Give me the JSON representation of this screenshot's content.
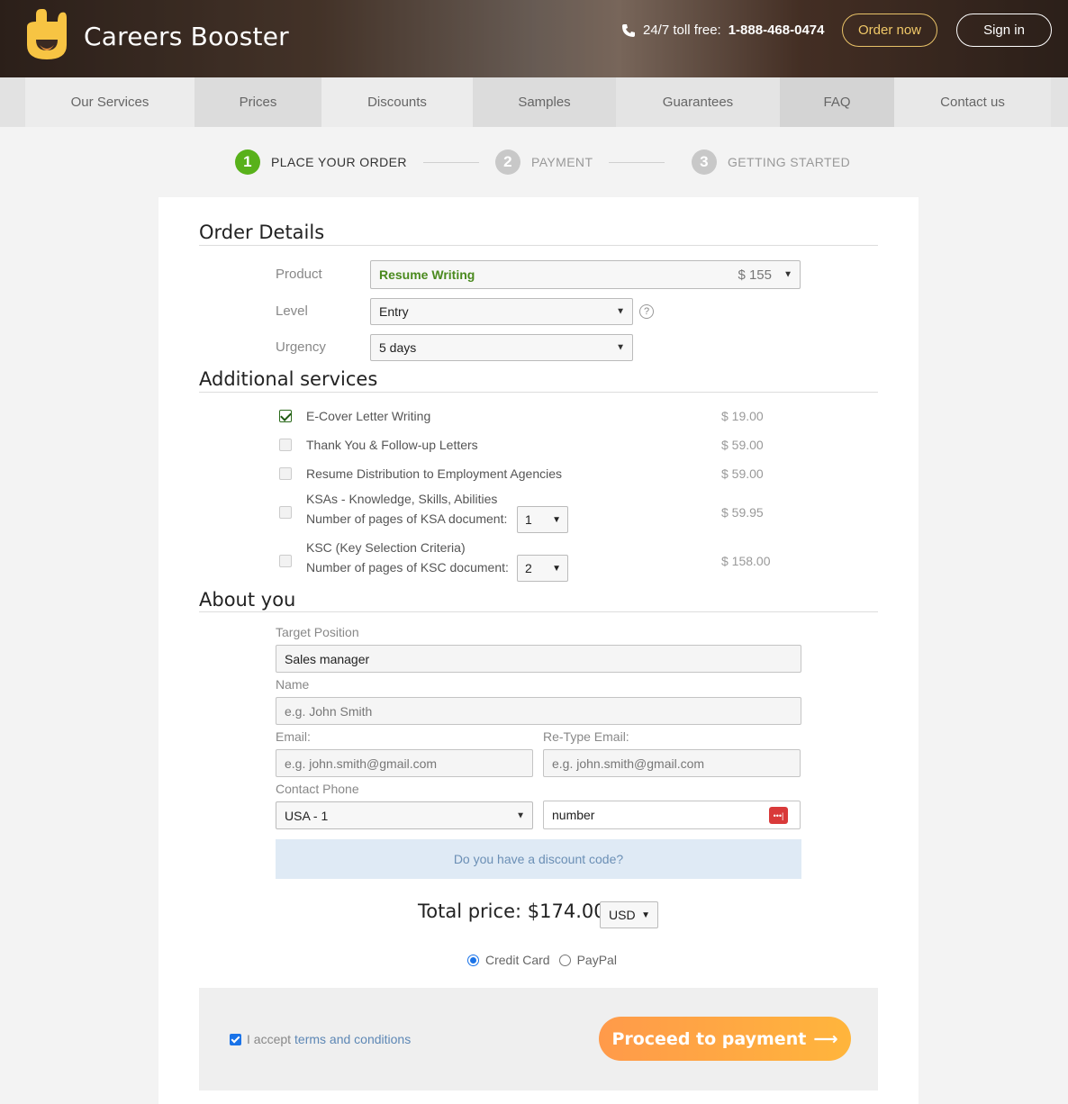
{
  "header": {
    "brand": "Careers Booster",
    "phone_label": "24/7 toll free:",
    "phone_number": "1-888-468-0474",
    "order_now": "Order now",
    "sign_in": "Sign in"
  },
  "nav": [
    "Our Services",
    "Prices",
    "Discounts",
    "Samples",
    "Guarantees",
    "FAQ",
    "Contact us"
  ],
  "steps": [
    {
      "num": "1",
      "label": "PLACE YOUR ORDER",
      "active": true
    },
    {
      "num": "2",
      "label": "PAYMENT",
      "active": false
    },
    {
      "num": "3",
      "label": "GETTING STARTED",
      "active": false
    }
  ],
  "order_details": {
    "title": "Order Details",
    "product_label": "Product",
    "product_value": "Resume Writing",
    "product_price": "$ 155",
    "level_label": "Level",
    "level_value": "Entry",
    "urgency_label": "Urgency",
    "urgency_value": "5 days",
    "help": "?"
  },
  "additional": {
    "title": "Additional services",
    "items": [
      {
        "label": "E-Cover Letter Writing",
        "price": "$ 19.00",
        "checked": true
      },
      {
        "label": "Thank You & Follow-up Letters",
        "price": "$ 59.00",
        "checked": false
      },
      {
        "label": "Resume Distribution to Employment Agencies",
        "price": "$ 59.00",
        "checked": false
      },
      {
        "label": "KSAs - Knowledge, Skills, Abilities",
        "sub": "Number of pages of KSA document:",
        "pages": "1",
        "price": "$ 59.95",
        "checked": false
      },
      {
        "label": "KSC (Key Selection Criteria)",
        "sub": "Number of pages of KSC document:",
        "pages": "2",
        "price": "$ 158.00",
        "checked": false
      }
    ]
  },
  "about": {
    "title": "About you",
    "target_label": "Target Position",
    "target_value": "Sales manager",
    "name_label": "Name",
    "name_placeholder": "e.g. John Smith",
    "email_label": "Email:",
    "email_placeholder": "e.g. john.smith@gmail.com",
    "retype_label": "Re-Type Email:",
    "retype_placeholder": "e.g. john.smith@gmail.com",
    "phone_label": "Contact Phone",
    "country_value": "USA - 1",
    "number_value": "number"
  },
  "discount_text": "Do you have a discount code?",
  "total": {
    "label": "Total price:",
    "value": "$174.00",
    "currency": "USD"
  },
  "payment": {
    "credit_card": "Credit Card",
    "paypal": "PayPal",
    "selected": "credit_card"
  },
  "footer": {
    "accept": "I accept",
    "terms_link": "terms and conditions",
    "proceed": "Proceed to payment"
  },
  "colors": {
    "accent_green": "#58b11a",
    "brand_orange": "#ffa743",
    "link_blue": "#5d87b5"
  }
}
